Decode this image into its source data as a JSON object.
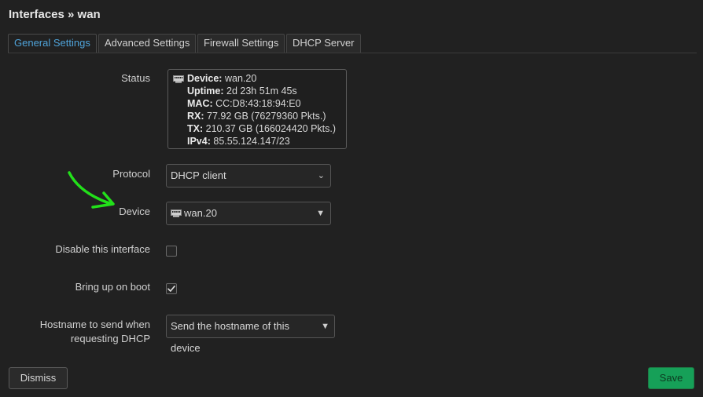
{
  "page": {
    "title": "Interfaces » wan"
  },
  "tabs": [
    {
      "label": "General Settings",
      "active": true
    },
    {
      "label": "Advanced Settings"
    },
    {
      "label": "Firewall Settings"
    },
    {
      "label": "DHCP Server"
    }
  ],
  "status": {
    "label": "Status",
    "device_key": "Device:",
    "device_val": "wan.20",
    "uptime_key": "Uptime:",
    "uptime_val": "2d 23h 51m 45s",
    "mac_key": "MAC:",
    "mac_val": "CC:D8:43:18:94:E0",
    "rx_key": "RX:",
    "rx_val": "77.92 GB (76279360 Pkts.)",
    "tx_key": "TX:",
    "tx_val": "210.37 GB (166024420 Pkts.)",
    "ipv4_key": "IPv4:",
    "ipv4_val": "85.55.124.147/23"
  },
  "protocol": {
    "label": "Protocol",
    "value": "DHCP client"
  },
  "device": {
    "label": "Device",
    "value": "wan.20"
  },
  "disable": {
    "label": "Disable this interface",
    "checked": false
  },
  "boot": {
    "label": "Bring up on boot",
    "checked": true
  },
  "hostname": {
    "label_line1": "Hostname to send when",
    "label_line2": "requesting DHCP",
    "value": "Send the hostname of this device"
  },
  "buttons": {
    "dismiss": "Dismiss",
    "save": "Save"
  },
  "colors": {
    "accent": "#4fa3d9",
    "save": "#16a058",
    "annotation_arrow": "#22e01a"
  },
  "icons": {
    "network_port": "ethernet-port-icon",
    "annotation": "hand-drawn-arrow"
  }
}
